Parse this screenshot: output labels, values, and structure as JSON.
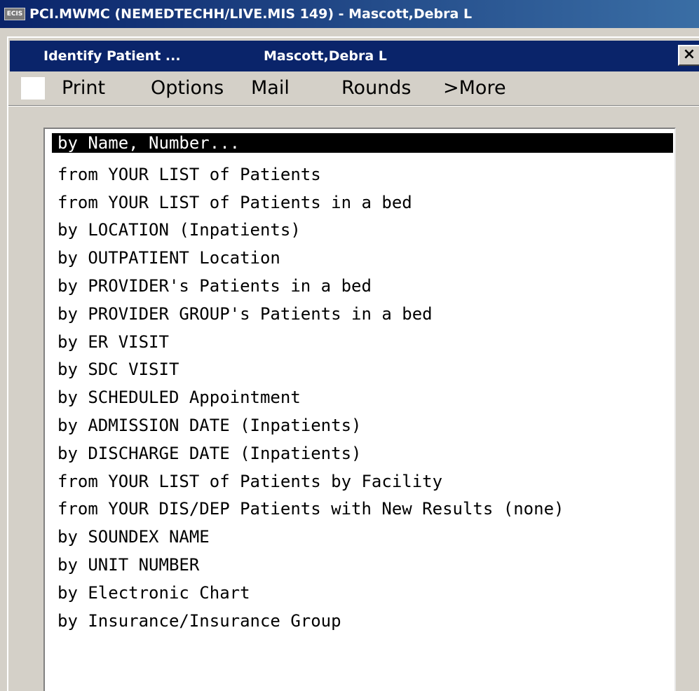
{
  "window": {
    "app_icon_label": "ECIS",
    "title": "PCI.MWMC (NEMEDTECHH/LIVE.MIS 149) - Mascott,Debra L"
  },
  "dialog": {
    "title_left": "Identify Patient ...",
    "title_right": "Mascott,Debra L",
    "close_label": "×"
  },
  "menu": {
    "items": [
      {
        "label": "Print"
      },
      {
        "label": "Options"
      },
      {
        "label": "Mail"
      },
      {
        "label": "Rounds"
      },
      {
        "label": ">More"
      }
    ]
  },
  "list": {
    "selected_index": 0,
    "items": [
      "by Name, Number...",
      "from YOUR LIST of Patients",
      "from YOUR LIST of Patients in a bed",
      "by LOCATION (Inpatients)",
      "by OUTPATIENT Location",
      "by PROVIDER's Patients in a bed",
      "by PROVIDER GROUP's Patients in a bed",
      "by ER VISIT",
      "by SDC VISIT",
      "by SCHEDULED Appointment",
      "by ADMISSION DATE (Inpatients)",
      "by DISCHARGE DATE (Inpatients)",
      "from YOUR LIST of Patients by Facility",
      "from YOUR DIS/DEP Patients with New Results (none)",
      "by SOUNDEX NAME",
      "by UNIT NUMBER",
      "by Electronic Chart",
      "by Insurance/Insurance Group"
    ]
  },
  "colors": {
    "title_bar": "#0a246a",
    "window_face": "#d4d0c8",
    "selection": "#000000"
  }
}
